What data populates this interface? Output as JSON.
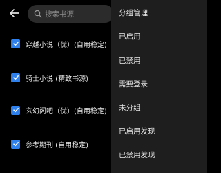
{
  "toolbar": {
    "search_placeholder": "搜索书源"
  },
  "sources": [
    {
      "label": "穿越小说（优）(自用稳定)",
      "checked": true
    },
    {
      "label": "骑士小说 (精致书源)",
      "checked": true
    },
    {
      "label": "玄幻阁吧（优）(自用稳定)",
      "checked": true
    },
    {
      "label": "参考期刊 (自用稳定)",
      "checked": true
    }
  ],
  "menu": {
    "items": [
      "分组管理",
      "已启用",
      "已禁用",
      "需要登录",
      "未分组",
      "已启用发现",
      "已禁用发现"
    ]
  },
  "colors": {
    "checkbox": "#2f80ed",
    "background": "#000000",
    "menu_background": "#1e1e1e"
  }
}
